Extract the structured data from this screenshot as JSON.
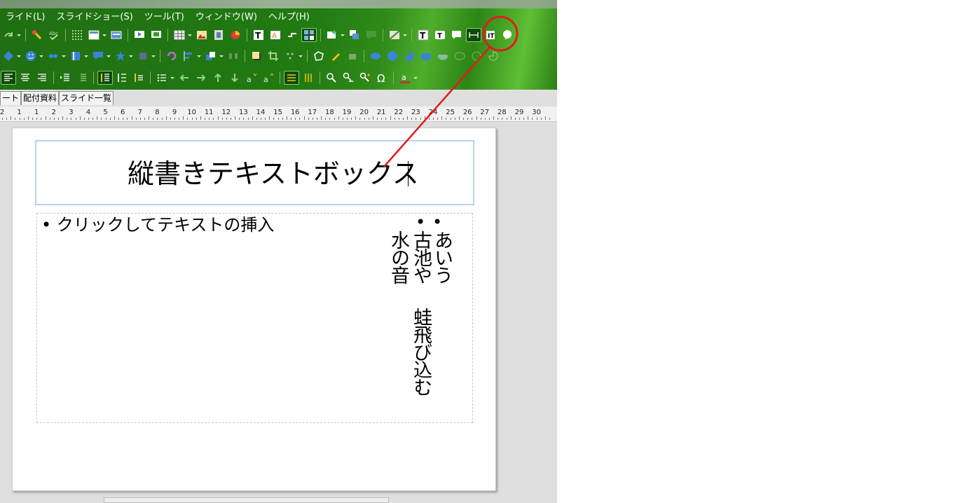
{
  "menu": {
    "items": [
      "ライド(L)",
      "スライドショー(S)",
      "ツール(T)",
      "ウィンドウ(W)",
      "ヘルプ(H)"
    ]
  },
  "view_tabs": [
    "ート",
    "配付資料",
    "スライド一覧"
  ],
  "ruler": {
    "labels": [
      "2",
      "1",
      "1",
      "2",
      "3",
      "4",
      "5",
      "6",
      "7",
      "8",
      "9",
      "10",
      "11",
      "12",
      "13",
      "14",
      "15",
      "16",
      "17",
      "18",
      "19",
      "20",
      "21",
      "22",
      "23",
      "24",
      "25",
      "26",
      "27",
      "28",
      "29",
      "30"
    ]
  },
  "slide": {
    "title": "縦書きテキストボックス",
    "bullet_marker": "•",
    "placeholder": "クリックしてテキストの挿入",
    "vertical_columns": [
      "あいう",
      "古池や",
      "蛙飛び込む",
      "水の音"
    ]
  },
  "colors": {
    "toolbar_green": "#217a12",
    "annotation_red": "#e01c1c",
    "title_selection": "#b8d3ef"
  },
  "icons": {
    "highlighted_tool": "vertical-text-icon"
  }
}
